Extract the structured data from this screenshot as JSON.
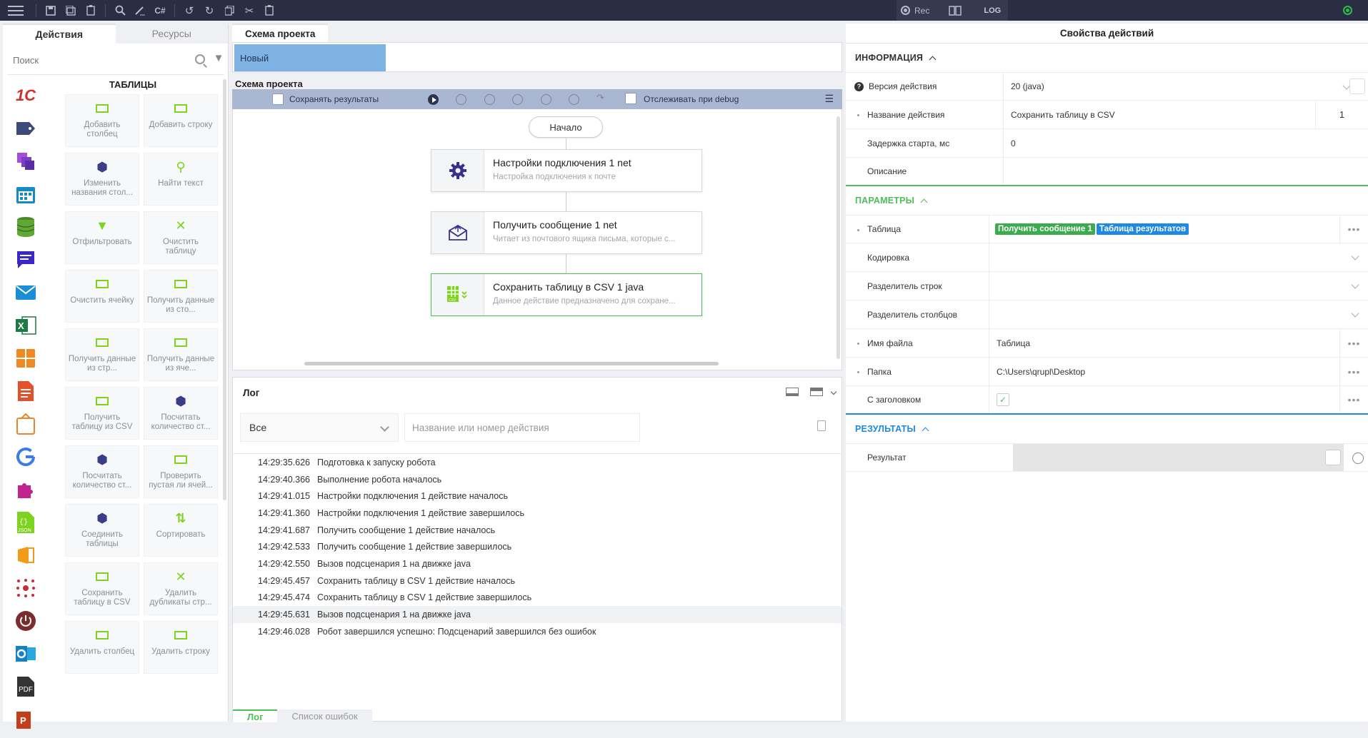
{
  "toolbar": {
    "csharp": "C#",
    "rec": "Rec",
    "log": "LOG"
  },
  "left": {
    "tabs": [
      "Действия",
      "Ресурсы"
    ],
    "search_placeholder": "Поиск",
    "category_title": "ТАБЛИЦЫ",
    "tiles": [
      {
        "label": "Добавить столбец",
        "icon": "add-column-icon"
      },
      {
        "label": "Добавить строку",
        "icon": "add-row-icon"
      },
      {
        "label": "Изменить названия стол...",
        "icon": "rename-columns-icon"
      },
      {
        "label": "Найти текст",
        "icon": "search-icon"
      },
      {
        "label": "Отфильтровать",
        "icon": "filter-icon"
      },
      {
        "label": "Очистить таблицу",
        "icon": "clear-table-icon"
      },
      {
        "label": "Очистить ячейку",
        "icon": "clear-cell-icon"
      },
      {
        "label": "Получить данные из сто...",
        "icon": "get-column-data-icon"
      },
      {
        "label": "Получить данные из стр...",
        "icon": "get-row-data-icon"
      },
      {
        "label": "Получить данные из яче...",
        "icon": "get-cell-data-icon"
      },
      {
        "label": "Получить таблицу из CSV",
        "icon": "csv-import-icon"
      },
      {
        "label": "Посчитать количество ст...",
        "icon": "count-columns-icon"
      },
      {
        "label": "Посчитать количество ст...",
        "icon": "count-rows-icon"
      },
      {
        "label": "Проверить пустая ли ячей...",
        "icon": "check-empty-cell-icon"
      },
      {
        "label": "Соединить таблицы",
        "icon": "join-tables-icon"
      },
      {
        "label": "Сортировать",
        "icon": "sort-icon"
      },
      {
        "label": "Сохранить таблицу в CSV",
        "icon": "csv-export-icon"
      },
      {
        "label": "Удалить дубликаты стр...",
        "icon": "remove-duplicates-icon"
      },
      {
        "label": "Удалить столбец",
        "icon": "delete-column-icon"
      },
      {
        "label": "Удалить строку",
        "icon": "delete-row-icon"
      }
    ]
  },
  "center": {
    "tab": "Схема проекта",
    "project_name": "Новый",
    "schema_title": "Схема проекта",
    "save_results": "Сохранять результаты",
    "debug_track": "Отслеживать при debug",
    "start": "Начало",
    "nodes": [
      {
        "title": "Настройки подключения  1  net",
        "subtitle": "Настройка подключения к почте"
      },
      {
        "title": "Получить сообщение  1  net",
        "subtitle": "Читает из почтового ящика письма, которые с..."
      },
      {
        "title": "Сохранить таблицу в CSV  1  java",
        "subtitle": "Данное действие предназначено для сохране..."
      }
    ]
  },
  "log": {
    "title": "Лог",
    "filter_value": "Все",
    "search_placeholder": "Название или номер действия",
    "rows": [
      {
        "time": "14:29:35.626",
        "text": "Подготовка к запуску робота"
      },
      {
        "time": "14:29:40.366",
        "text": "Выполнение робота началось"
      },
      {
        "time": "14:29:41.015",
        "text": "Настройки подключения 1 действие началось"
      },
      {
        "time": "14:29:41.360",
        "text": "Настройки подключения 1 действие завершилось"
      },
      {
        "time": "14:29:41.687",
        "text": "Получить сообщение 1 действие началось"
      },
      {
        "time": "14:29:42.533",
        "text": "Получить сообщение 1 действие завершилось"
      },
      {
        "time": "14:29:42.550",
        "text": "Вызов подсценария 1 на движке java"
      },
      {
        "time": "14:29:45.457",
        "text": "Сохранить таблицу в CSV 1 действие началось"
      },
      {
        "time": "14:29:45.474",
        "text": "Сохранить таблицу в CSV 1 действие завершилось"
      },
      {
        "time": "14:29:45.631",
        "text": "Вызов подсценария 1 на движке java"
      },
      {
        "time": "14:29:46.028",
        "text": "Робот завершился успешно: Подсценарий завершился без ошибок"
      }
    ],
    "tabs": [
      "Лог",
      "Список ошибок"
    ]
  },
  "props": {
    "title": "Свойства действий",
    "info_label": "ИНФОРМАЦИЯ",
    "params_label": "ПАРАМЕТРЫ",
    "results_label": "РЕЗУЛЬТАТЫ",
    "version_label": "Версия действия",
    "version_value": "20 (java)",
    "name_label": "Название действия",
    "name_value": "Сохранить таблицу в CSV",
    "name_num": "1",
    "delay_label": "Задержка старта, мс",
    "delay_value": "0",
    "desc_label": "Описание",
    "desc_value": "",
    "table_label": "Таблица",
    "table_pill1": "Получить сообщение 1",
    "table_pill2": "Таблица результатов",
    "encoding_label": "Кодировка",
    "rowsep_label": "Разделитель строк",
    "colsep_label": "Разделитель столбцов",
    "filename_label": "Имя файла",
    "filename_value": "Таблица",
    "folder_label": "Папка",
    "folder_value": "C:\\Users\\qrupl\\Desktop",
    "header_label": "С заголовком",
    "result_label": "Результат"
  },
  "colors": {
    "accent_green": "#4cbf58",
    "info_blue": "#1e88e5",
    "topbar": "#2b2d42"
  }
}
